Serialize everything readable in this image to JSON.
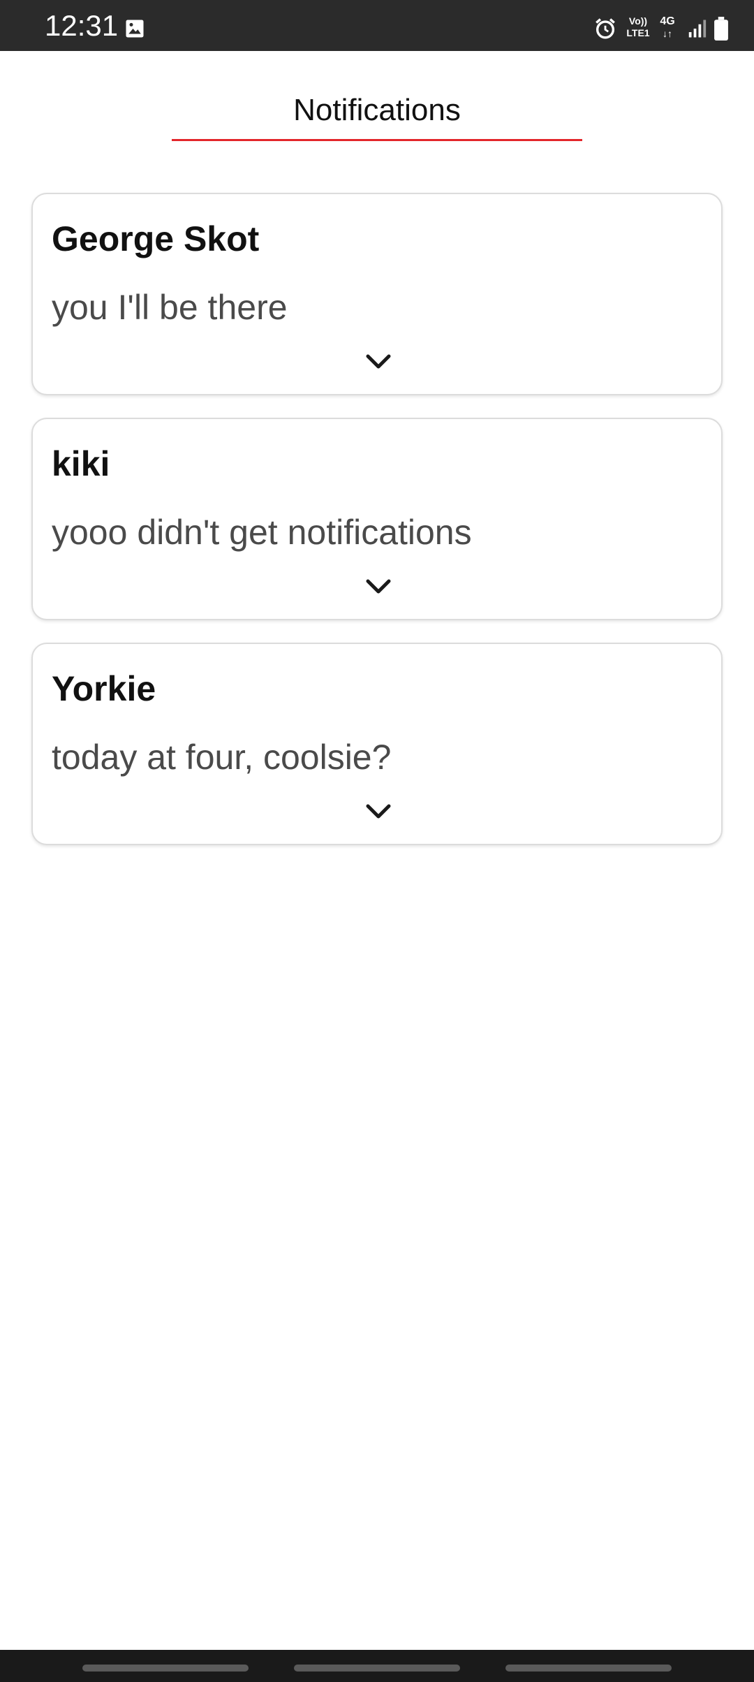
{
  "status_bar": {
    "time": "12:31",
    "volte_line1": "Vo))",
    "volte_line2": "LTE1",
    "network": "4G",
    "icons": [
      "gallery-icon",
      "alarm-icon",
      "signal-icon",
      "battery-icon"
    ]
  },
  "header": {
    "title": "Notifications",
    "accent_color": "#e3262b"
  },
  "notifications": [
    {
      "name": "George Skot",
      "message": "you I'll be there"
    },
    {
      "name": "kiki",
      "message": "yooo didn't get notifications"
    },
    {
      "name": "Yorkie",
      "message": "today at four, coolsie?"
    }
  ]
}
